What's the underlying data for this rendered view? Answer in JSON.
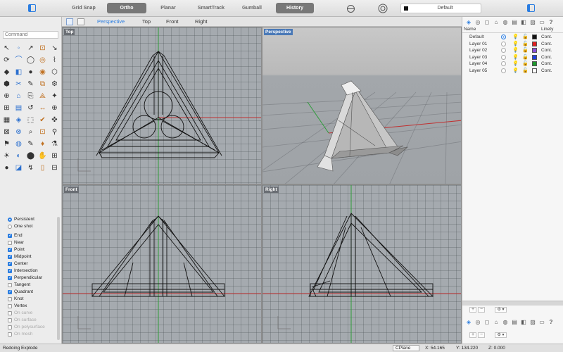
{
  "toolbar": {
    "toggles": [
      {
        "label": "Grid Snap",
        "on": false
      },
      {
        "label": "Ortho",
        "on": true
      },
      {
        "label": "Planar",
        "on": false
      },
      {
        "label": "SmartTrack",
        "on": false
      },
      {
        "label": "Gumball",
        "on": false
      },
      {
        "label": "History",
        "on": true
      }
    ],
    "current_layer": "Default"
  },
  "command": {
    "placeholder": "Command"
  },
  "tools": [
    "↖",
    "◦",
    "↗",
    "⊡",
    "↘",
    "⟳",
    "⌒",
    "◯",
    "◎",
    "⌇",
    "◆",
    "◧",
    "●",
    "◉",
    "⬡",
    "⬢",
    "✂",
    "✎",
    "⧉",
    "⚙",
    "⊕",
    "⌂",
    "⎘",
    "⟁",
    "✦",
    "⊞",
    "▤",
    "↺",
    "↔",
    "⊕",
    "▦",
    "◈",
    "⬚",
    "✔",
    "✜",
    "⊠",
    "⊗",
    "⌕",
    "⊡",
    "⚲",
    "⚑",
    "◍",
    "✎",
    "♦",
    "⚗",
    "☀",
    "◐",
    "⬤",
    "✋",
    "⊞",
    "●",
    "◪",
    "↯",
    "▯",
    "⊟"
  ],
  "osnap": {
    "mode": [
      {
        "label": "Persistent",
        "checked": true
      },
      {
        "label": "One shot",
        "checked": false
      }
    ],
    "items": [
      {
        "label": "End",
        "checked": true,
        "enabled": true
      },
      {
        "label": "Near",
        "checked": false,
        "enabled": true
      },
      {
        "label": "Point",
        "checked": true,
        "enabled": true
      },
      {
        "label": "Midpoint",
        "checked": true,
        "enabled": true
      },
      {
        "label": "Center",
        "checked": true,
        "enabled": true
      },
      {
        "label": "Intersection",
        "checked": true,
        "enabled": true
      },
      {
        "label": "Perpendicular",
        "checked": true,
        "enabled": true
      },
      {
        "label": "Tangent",
        "checked": false,
        "enabled": true
      },
      {
        "label": "Quadrant",
        "checked": true,
        "enabled": true
      },
      {
        "label": "Knot",
        "checked": false,
        "enabled": true
      },
      {
        "label": "Vertex",
        "checked": false,
        "enabled": true
      },
      {
        "label": "On curve",
        "checked": false,
        "enabled": false
      },
      {
        "label": "On surface",
        "checked": false,
        "enabled": false
      },
      {
        "label": "On polysurface",
        "checked": false,
        "enabled": false
      },
      {
        "label": "On mesh",
        "checked": false,
        "enabled": false
      }
    ]
  },
  "viewport_tabs": [
    {
      "label": "Perspective",
      "active": true
    },
    {
      "label": "Top",
      "active": false
    },
    {
      "label": "Front",
      "active": false
    },
    {
      "label": "Right",
      "active": false
    }
  ],
  "viewports": {
    "top": "Top",
    "perspective": "Perspective",
    "front": "Front",
    "right": "Right"
  },
  "layers_panel": {
    "col_name": "Name",
    "col_linetype": "Linety",
    "layers": [
      {
        "name": "Default",
        "active": true,
        "color": "#111111",
        "linetype": "Cont."
      },
      {
        "name": "Layer 01",
        "active": false,
        "color": "#e02020",
        "linetype": "Cont."
      },
      {
        "name": "Layer 02",
        "active": false,
        "color": "#8a4fd8",
        "linetype": "Cont."
      },
      {
        "name": "Layer 03",
        "active": false,
        "color": "#1f3fe0",
        "linetype": "Cont."
      },
      {
        "name": "Layer 04",
        "active": false,
        "color": "#1e9b2e",
        "linetype": "Cont."
      },
      {
        "name": "Layer 05",
        "active": false,
        "color": "#ffffff",
        "linetype": "Cont."
      }
    ]
  },
  "status": {
    "message": "Redoing Explode",
    "cplane": "CPlane",
    "x": "X: 54.165",
    "y": "Y: 134.220",
    "z": "Z: 0.000"
  },
  "colors": {
    "accent": "#2a7de1",
    "viewport_bg": "#a5aaaf"
  }
}
